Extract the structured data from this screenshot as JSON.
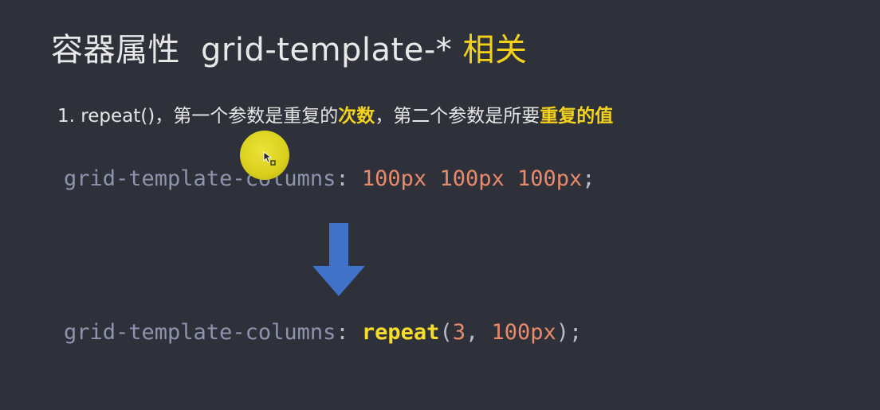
{
  "slide": {
    "title": {
      "prefix": "容器属性",
      "code": "grid-template-*",
      "highlight": "相关"
    },
    "point": {
      "number": "1.",
      "text_a": " repeat()，",
      "text_b": "第一个参数是重复的",
      "strong_a": "次数",
      "text_c": "，第二个参数是所要",
      "strong_b": "重复的值"
    },
    "code_before": {
      "property": "grid-template-columns",
      "colon": ": ",
      "value_1": "100px",
      "value_2": "100px",
      "value_3": "100px",
      "semicolon": ";"
    },
    "code_after": {
      "property": "grid-template-columns",
      "colon": ": ",
      "function": "repeat",
      "open_paren": "(",
      "count": "3",
      "comma": ", ",
      "value": "100px",
      "close": ");"
    }
  },
  "colors": {
    "background": "#2f313a",
    "title_text": "#e9e9e9",
    "highlight_yellow": "#f2d11a",
    "property_gray": "#8e94ad",
    "number_orange": "#e88b6c",
    "arrow_blue": "#3f72c8",
    "cursor_halo": "#e2d727"
  },
  "icons": {
    "arrow": "arrow-down-icon",
    "cursor": "mouse-pointer-icon"
  }
}
